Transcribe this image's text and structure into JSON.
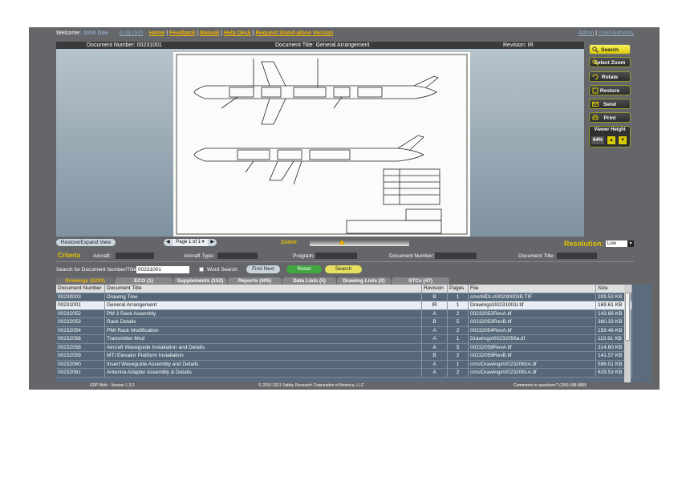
{
  "topbar": {
    "welcome": "Welcome:",
    "user": "John Doe",
    "logout": "(Log Out)",
    "links": [
      "Home",
      "Feedback",
      "Manual",
      "Help Desk",
      "Request Stand-alone Version"
    ],
    "right_links": [
      "Admin",
      "User Authority"
    ]
  },
  "document": {
    "number_label": "Document Number: 00231001",
    "title_label": "Document Title: General Arrangement",
    "revision_label": "Revision: IR"
  },
  "tools": {
    "search": "Search",
    "select_zoom": "Select Zoom",
    "rotate": "Rotate",
    "restore": "Restore",
    "send": "Send",
    "print": "Print",
    "viewer_height_label": "Viewer Height",
    "viewer_height_value": "64%"
  },
  "controls": {
    "restore_expand": "Restore/Expand View",
    "page_text": "Page 1 of 1",
    "zoom_label": "Zoom:",
    "resolution_label": "Resolution:",
    "resolution_value": "Low"
  },
  "criteria": {
    "label": "Criteria",
    "aircraft": "Aircraft:",
    "aircraft_type": "Aircraft Type:",
    "program": "Program:",
    "document_number": "Document Number:",
    "document_title": "Document Title:",
    "search_label": "Search for Document Number/Title:",
    "search_value": "00231001",
    "word_search": "Word Search",
    "find_next": "Find Next",
    "reset": "Reset",
    "search": "Search"
  },
  "tabs": [
    "Drawings (5293)",
    "ECO (1)",
    "Supplements (152)",
    "Reports (405)",
    "Data Lists (5)",
    "Drawing Lists (2)",
    "STCs (47)"
  ],
  "table": {
    "headers": [
      "Document Number",
      "Document Title",
      "Revision",
      "Pages",
      "File",
      "Size"
    ],
    "rows": [
      [
        "00230003",
        "Drawing Tree",
        "B",
        "1",
        "cms\\MDLs\\00230003B.TIF",
        "209.53 KB"
      ],
      [
        "00231001",
        "General Arrangement",
        "IR",
        "1",
        "Drawings\\00231001r.tif",
        "169.61 KB"
      ],
      [
        "00232052",
        "PM 3 Rack Assembly",
        "A",
        "2",
        "00232052RevA.tif",
        "143.66 KB"
      ],
      [
        "00232053",
        "Rack Details",
        "B",
        "5",
        "00232053RevB.tif",
        "360.33 KB"
      ],
      [
        "00232054",
        "PMI Rack Modification",
        "A",
        "2",
        "00232054RevA.tif",
        "159.46 KB"
      ],
      [
        "00232056",
        "Transmitter Mod",
        "A",
        "1",
        "Drawings\\00232056a.tif",
        "110.91 KB"
      ],
      [
        "00232058",
        "Aircraft Waveguide Installation and Details",
        "A",
        "5",
        "00232058RevA.tif",
        "314.60 KB"
      ],
      [
        "00232059",
        "MTI Elevator Platform Installation",
        "B",
        "2",
        "00232059RevB.tif",
        "141.57 KB"
      ],
      [
        "00232060",
        "Insert Waveguide Assembly and Details",
        "A",
        "1",
        "cms\\Drawings\\00232060A.tif",
        "586.01 KB"
      ],
      [
        "00232061",
        "Antenna Adapter Assembly & Details",
        "A",
        "2",
        "cms\\Drawings\\00232061A.tif",
        "629.53 KB"
      ]
    ]
  },
  "footer": {
    "version": "ERP Web - Version 1.3.2",
    "copyright": "© 2010-2011 Safety Research Corporation of America, LLC",
    "contact": "Comments or questions? (334) 598-8865"
  },
  "colors": {
    "accent": "#f0b400",
    "frame": "#646669",
    "row": "#556779"
  }
}
